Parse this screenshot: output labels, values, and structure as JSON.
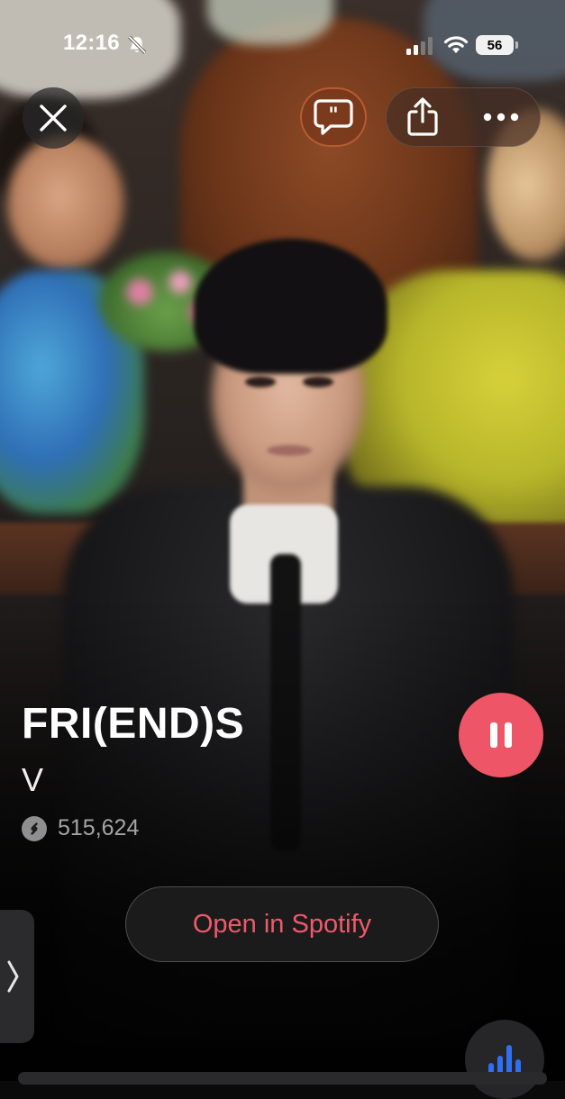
{
  "status_bar": {
    "time": "12:16",
    "battery": "56",
    "icons": [
      "bell-slash-icon",
      "cellular-signal-icon",
      "wifi-icon",
      "battery-icon"
    ]
  },
  "top_controls": {
    "close_icon": "close-icon",
    "lyrics_icon": "quote-bubble-icon",
    "share_icon": "share-icon",
    "more_icon": "more-icon",
    "accent_color": "#e0703f"
  },
  "track": {
    "title": "FRI(END)S",
    "artist": "V",
    "shazam_count": "515,624",
    "count_icon": "shazam-icon"
  },
  "controls": {
    "pause_icon": "pause-icon",
    "pause_color": "#ee5566",
    "open_label": "Open in Spotify",
    "open_label_color": "#ee5a6a",
    "side_tab_icon": "chevron-right-icon",
    "bars_icon": "equalizer-bars-icon",
    "bars_color": "#2f6ff0"
  }
}
